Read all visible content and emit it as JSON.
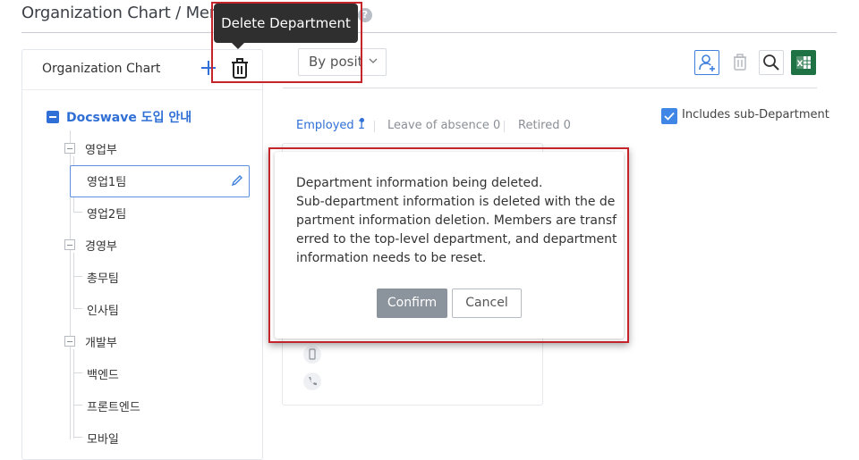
{
  "page": {
    "title": "Organization Chart / Mem"
  },
  "left_panel": {
    "title": "Organization Chart",
    "add_icon": "plus-icon",
    "delete_icon": "trash-icon"
  },
  "tooltip": {
    "text": "Delete Department"
  },
  "tree": {
    "root": "Docswave 도입 안내",
    "groups": [
      {
        "label": "영업부",
        "children": [
          "영업1팀",
          "영업2팀"
        ]
      },
      {
        "label": "경영부",
        "children": [
          "총무팀",
          "인사팀"
        ]
      },
      {
        "label": "개발부",
        "children": [
          "백엔드",
          "프론트엔드",
          "모바일"
        ]
      }
    ],
    "selected": "영업1팀"
  },
  "toolbar": {
    "sort_value": "By position",
    "icons": [
      "add-user-icon",
      "trash-icon",
      "search-icon",
      "excel-icon"
    ]
  },
  "tabs": [
    {
      "label": "Employed 1",
      "active": true
    },
    {
      "label": "Leave of absence 0",
      "active": false
    },
    {
      "label": "Retired 0",
      "active": false
    }
  ],
  "filter": {
    "includes_sub_label": "Includes sub-Department",
    "checked": true
  },
  "dialog": {
    "lines": [
      "Department information being deleted.",
      "Sub-department information is deleted with the de",
      "partment information deletion. Members are transf",
      "erred to the top-level department, and department",
      "information needs to be reset."
    ],
    "confirm_label": "Confirm",
    "cancel_label": "Cancel"
  },
  "colors": {
    "accent": "#2f6fd6",
    "highlight": "#c6242b",
    "excel": "#1f7244",
    "confirm_bg": "#8b939c"
  }
}
